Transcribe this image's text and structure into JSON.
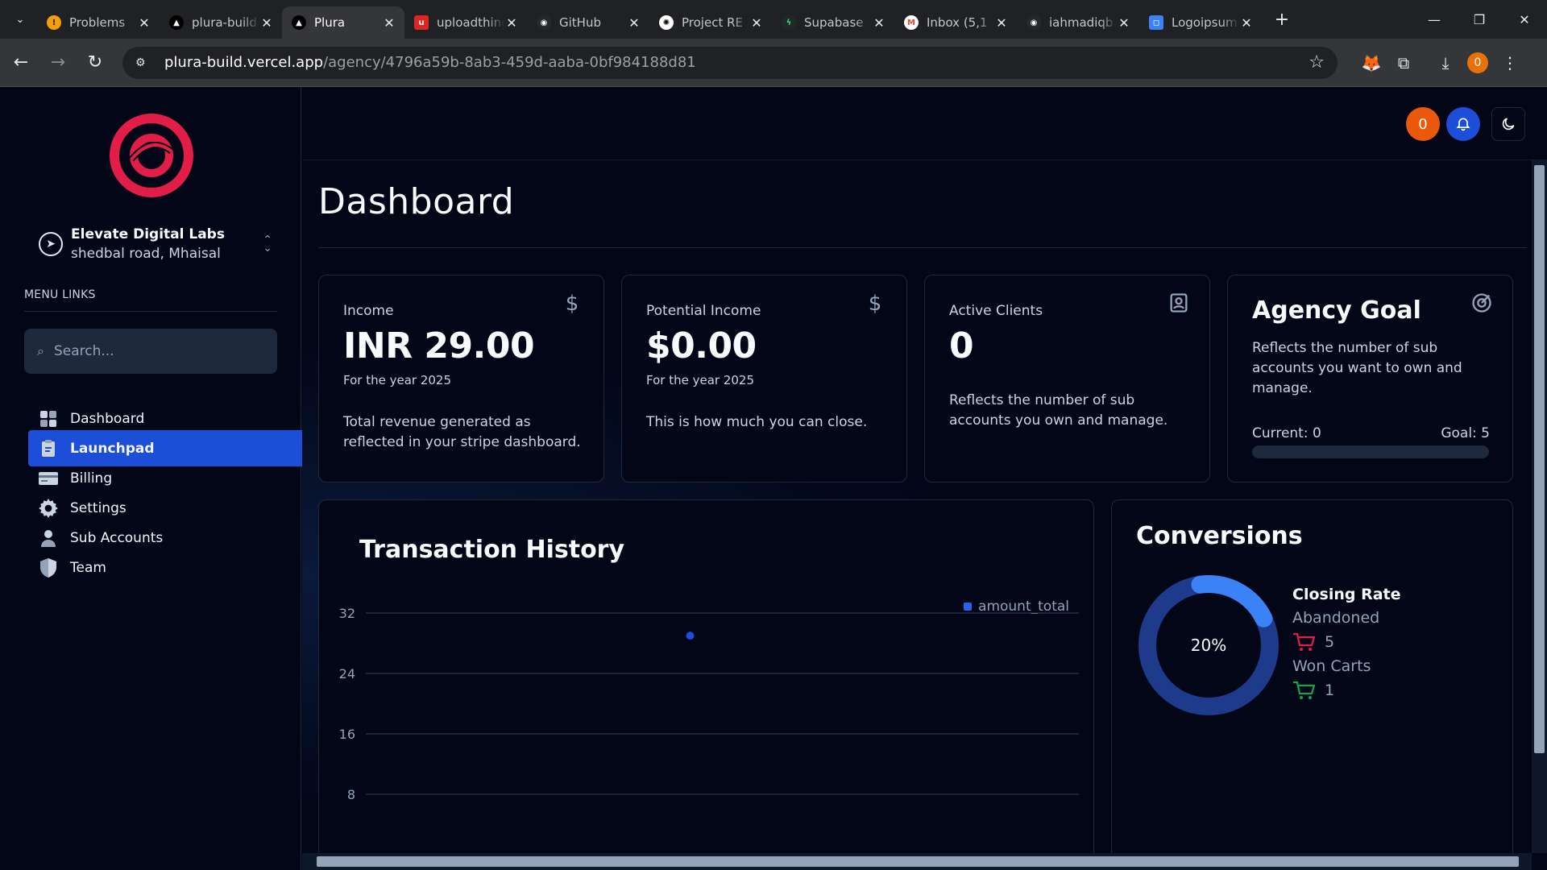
{
  "browser": {
    "tabs": [
      {
        "label": "Problems",
        "favicon": "warning-icon",
        "active": false
      },
      {
        "label": "plura-build",
        "favicon": "vercel-icon",
        "active": false
      },
      {
        "label": "Plura",
        "favicon": "vercel-icon",
        "active": true
      },
      {
        "label": "uploadthing",
        "favicon": "uploadthing-icon",
        "active": false
      },
      {
        "label": "GitHub",
        "favicon": "github-icon",
        "active": false
      },
      {
        "label": "Project RE",
        "favicon": "openai-icon",
        "active": false
      },
      {
        "label": "Supabase",
        "favicon": "supabase-icon",
        "active": false
      },
      {
        "label": "Inbox (5,1",
        "favicon": "gmail-icon",
        "active": false
      },
      {
        "label": "iahmadiqb",
        "favicon": "github-icon",
        "active": false
      },
      {
        "label": "Logoipsum",
        "favicon": "logoipsum-icon",
        "active": false
      }
    ],
    "url_host": "plura-build.vercel.app",
    "url_path": "/agency/4796a59b-8ab3-459d-aaba-0bf984188d81",
    "profile_initial": "0"
  },
  "sidebar": {
    "org_name": "Elevate Digital Labs",
    "org_address": "shedbal road, Mhaisal",
    "menu_heading": "MENU LINKS",
    "search_placeholder": "Search...",
    "items": [
      {
        "label": "Dashboard",
        "icon": "dashboard-icon",
        "active": false
      },
      {
        "label": "Launchpad",
        "icon": "clipboard-icon",
        "active": true
      },
      {
        "label": "Billing",
        "icon": "credit-card-icon",
        "active": false
      },
      {
        "label": "Settings",
        "icon": "gear-icon",
        "active": false
      },
      {
        "label": "Sub Accounts",
        "icon": "person-icon",
        "active": false
      },
      {
        "label": "Team",
        "icon": "shield-icon",
        "active": false
      }
    ]
  },
  "topbar": {
    "user_initial": "0"
  },
  "main": {
    "title": "Dashboard",
    "cards": {
      "income": {
        "label": "Income",
        "value": "INR 29.00",
        "sub": "For the year 2025",
        "desc": "Total revenue generated as reflected in your stripe dashboard."
      },
      "potential": {
        "label": "Potential Income",
        "value": "$0.00",
        "sub": "For the year 2025",
        "desc": "This is how much you can close."
      },
      "clients": {
        "label": "Active Clients",
        "value": "0",
        "desc": "Reflects the number of sub accounts you own and manage."
      },
      "goal": {
        "title": "Agency Goal",
        "desc": "Reflects the number of sub accounts you want to own and manage.",
        "current_label": "Current: 0",
        "goal_label": "Goal: 5",
        "progress_fraction": 0
      }
    },
    "transactions": {
      "title": "Transaction History",
      "legend": "amount_total"
    },
    "conversions": {
      "title": "Conversions",
      "rate_label": "20%",
      "closing_rate_label": "Closing Rate",
      "abandoned_label": "Abandoned",
      "abandoned_count": "5",
      "won_label": "Won Carts",
      "won_count": "1",
      "rate_fraction": 0.2
    }
  },
  "colors": {
    "accent": "#2563eb",
    "active_nav": "#1d4ed8",
    "brand_red": "#e11d48",
    "abandoned_cart": "#e11d48",
    "won_cart": "#16a34a",
    "donut_track": "#1e3a8a",
    "donut_fill": "#3b82f6",
    "orange_badge": "#ea580c"
  },
  "chart_data": {
    "type": "scatter",
    "title": "Transaction History",
    "series": [
      {
        "name": "amount_total",
        "values": [
          {
            "x": "",
            "y": 29
          }
        ]
      }
    ],
    "yticks": [
      "32",
      "24",
      "16",
      "8"
    ],
    "ylim": [
      0,
      32
    ],
    "grid": true,
    "legend": "top-right"
  }
}
